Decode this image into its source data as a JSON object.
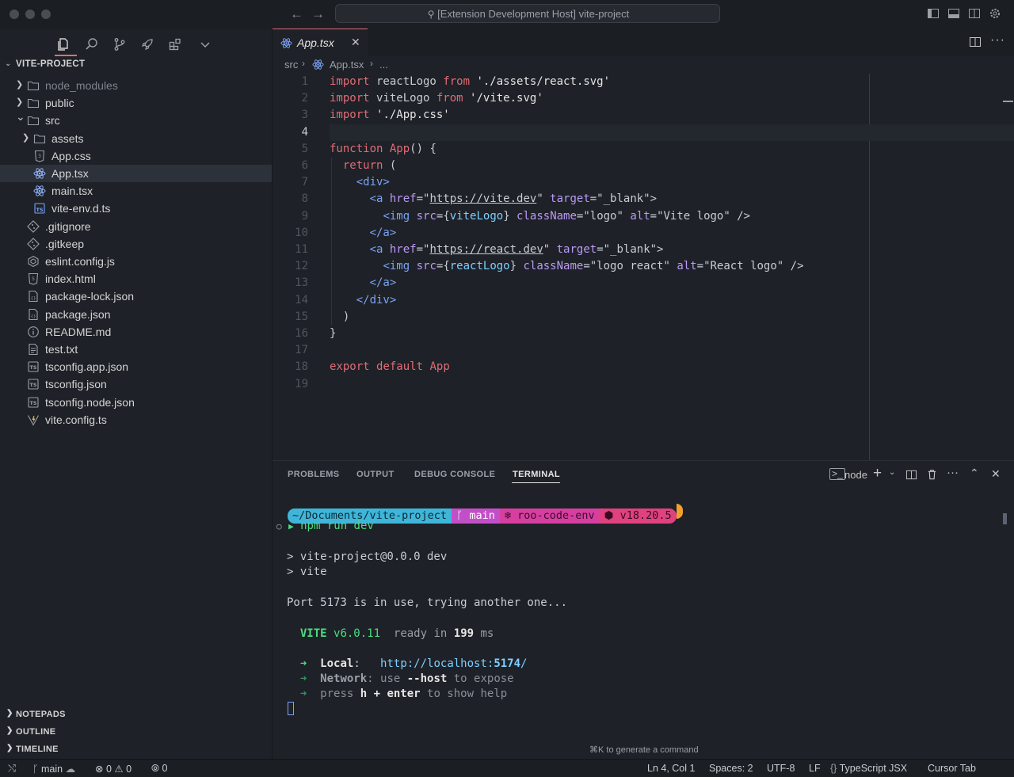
{
  "window": {
    "search_text": "[Extension Development Host] vite-project"
  },
  "explorer": {
    "title": "VITE-PROJECT",
    "items": [
      {
        "label": "node_modules",
        "icon": "folder-icon",
        "kind": "folder-collapsed",
        "depth": 0,
        "dim": true
      },
      {
        "label": "public",
        "icon": "folder-icon",
        "kind": "folder-collapsed",
        "depth": 0
      },
      {
        "label": "src",
        "icon": "folder-icon",
        "kind": "folder-expanded",
        "depth": 0
      },
      {
        "label": "assets",
        "icon": "folder-icon",
        "kind": "folder-collapsed",
        "depth": 1
      },
      {
        "label": "App.css",
        "icon": "css-icon",
        "kind": "file",
        "depth": 1
      },
      {
        "label": "App.tsx",
        "icon": "react-icon",
        "kind": "file",
        "depth": 1,
        "selected": true
      },
      {
        "label": "main.tsx",
        "icon": "react-icon",
        "kind": "file",
        "depth": 1
      },
      {
        "label": "vite-env.d.ts",
        "icon": "ts-icon",
        "kind": "file",
        "depth": 1
      },
      {
        "label": ".gitignore",
        "icon": "git-icon",
        "kind": "file",
        "depth": 0
      },
      {
        "label": ".gitkeep",
        "icon": "git-icon",
        "kind": "file",
        "depth": 0
      },
      {
        "label": "eslint.config.js",
        "icon": "eslint-icon",
        "kind": "file",
        "depth": 0
      },
      {
        "label": "index.html",
        "icon": "html-icon",
        "kind": "file",
        "depth": 0
      },
      {
        "label": "package-lock.json",
        "icon": "json-icon",
        "kind": "file",
        "depth": 0
      },
      {
        "label": "package.json",
        "icon": "json-icon",
        "kind": "file",
        "depth": 0
      },
      {
        "label": "README.md",
        "icon": "info-icon",
        "kind": "file",
        "depth": 0
      },
      {
        "label": "test.txt",
        "icon": "text-file-icon",
        "kind": "file",
        "depth": 0
      },
      {
        "label": "tsconfig.app.json",
        "icon": "ts-config-icon",
        "kind": "file",
        "depth": 0
      },
      {
        "label": "tsconfig.json",
        "icon": "ts-config-icon",
        "kind": "file",
        "depth": 0
      },
      {
        "label": "tsconfig.node.json",
        "icon": "ts-config-icon",
        "kind": "file",
        "depth": 0
      },
      {
        "label": "vite.config.ts",
        "icon": "vite-icon",
        "kind": "file",
        "depth": 0
      }
    ],
    "sections": [
      "NOTEPADS",
      "OUTLINE",
      "TIMELINE"
    ]
  },
  "editor": {
    "tab_label": "App.tsx",
    "breadcrumb": {
      "folder": "src",
      "file": "App.tsx",
      "more": "..."
    },
    "current_line": 4,
    "lines": [
      [
        [
          "kw",
          "import"
        ],
        [
          "pn",
          " reactLogo "
        ],
        [
          "kw",
          "from"
        ],
        [
          "pn",
          " "
        ],
        [
          "str",
          "'./assets/react.svg'"
        ]
      ],
      [
        [
          "kw",
          "import"
        ],
        [
          "pn",
          " viteLogo "
        ],
        [
          "kw",
          "from"
        ],
        [
          "pn",
          " "
        ],
        [
          "str",
          "'/vite.svg'"
        ]
      ],
      [
        [
          "kw",
          "import"
        ],
        [
          "pn",
          " "
        ],
        [
          "str",
          "'./App.css'"
        ]
      ],
      [],
      [
        [
          "kw",
          "function"
        ],
        [
          "pn",
          " "
        ],
        [
          "fn",
          "App"
        ],
        [
          "pn",
          "() {"
        ]
      ],
      [
        [
          "pn",
          "  "
        ],
        [
          "kw",
          "return"
        ],
        [
          "pn",
          " ("
        ]
      ],
      [
        [
          "pn",
          "    "
        ],
        [
          "tag",
          "<div>"
        ]
      ],
      [
        [
          "pn",
          "      "
        ],
        [
          "tag",
          "<a"
        ],
        [
          "pn",
          " "
        ],
        [
          "attr",
          "href"
        ],
        [
          "pn",
          "=\""
        ],
        [
          "ul",
          "https://vite.dev"
        ],
        [
          "pn",
          "\" "
        ],
        [
          "attr",
          "target"
        ],
        [
          "pn",
          "=\"_blank\">"
        ]
      ],
      [
        [
          "pn",
          "        "
        ],
        [
          "tag",
          "<img"
        ],
        [
          "pn",
          " "
        ],
        [
          "attr",
          "src"
        ],
        [
          "pn",
          "={"
        ],
        [
          "var",
          "viteLogo"
        ],
        [
          "pn",
          "} "
        ],
        [
          "attr",
          "className"
        ],
        [
          "pn",
          "=\"logo\" "
        ],
        [
          "attr",
          "alt"
        ],
        [
          "pn",
          "=\"Vite logo\" />"
        ]
      ],
      [
        [
          "pn",
          "      "
        ],
        [
          "tag",
          "</a>"
        ]
      ],
      [
        [
          "pn",
          "      "
        ],
        [
          "tag",
          "<a"
        ],
        [
          "pn",
          " "
        ],
        [
          "attr",
          "href"
        ],
        [
          "pn",
          "=\""
        ],
        [
          "ul",
          "https://react.dev"
        ],
        [
          "pn",
          "\" "
        ],
        [
          "attr",
          "target"
        ],
        [
          "pn",
          "=\"_blank\">"
        ]
      ],
      [
        [
          "pn",
          "        "
        ],
        [
          "tag",
          "<img"
        ],
        [
          "pn",
          " "
        ],
        [
          "attr",
          "src"
        ],
        [
          "pn",
          "={"
        ],
        [
          "var",
          "reactLogo"
        ],
        [
          "pn",
          "} "
        ],
        [
          "attr",
          "className"
        ],
        [
          "pn",
          "=\"logo react\" "
        ],
        [
          "attr",
          "alt"
        ],
        [
          "pn",
          "=\"React logo\" />"
        ]
      ],
      [
        [
          "pn",
          "      "
        ],
        [
          "tag",
          "</a>"
        ]
      ],
      [
        [
          "pn",
          "    "
        ],
        [
          "tag",
          "</div>"
        ]
      ],
      [
        [
          "pn",
          "  )"
        ]
      ],
      [
        [
          "pn",
          "}"
        ]
      ],
      [],
      [
        [
          "kw",
          "export"
        ],
        [
          "pn",
          " "
        ],
        [
          "kw",
          "default"
        ],
        [
          "pn",
          " "
        ],
        [
          "fn",
          "App"
        ]
      ],
      []
    ]
  },
  "panel": {
    "tabs": [
      "PROBLEMS",
      "OUTPUT",
      "DEBUG CONSOLE",
      "TERMINAL"
    ],
    "active_tab": "TERMINAL",
    "terminal_name": "node",
    "prompt": {
      "path": "~/Documents/vite-project",
      "branch": "main",
      "env": "roo-code-env",
      "node": "v18.20.5"
    },
    "command": "npm run dev",
    "output": {
      "line1": "> vite-project@0.0.0 dev",
      "line2": "> vite",
      "port_msg": "Port 5173 is in use, trying another one...",
      "vite": "VITE",
      "vite_version": "v6.0.11",
      "ready": "ready in",
      "ready_ms": "199",
      "ms": "ms",
      "local_label": "Local",
      "local_url_prefix": "http://localhost:",
      "local_port": "5174",
      "local_url_suffix": "/",
      "network_label": "Network",
      "network_text_a": ": use ",
      "network_flag": "--host",
      "network_text_b": " to expose",
      "help_a": "press ",
      "help_key": "h + enter",
      "help_b": " to show help"
    },
    "hint": "⌘K to generate a command"
  },
  "statusbar": {
    "branch": "main",
    "errors": "0",
    "warnings": "0",
    "ports": "0",
    "position": "Ln 4, Col 1",
    "spaces": "Spaces: 2",
    "encoding": "UTF-8",
    "eol": "LF",
    "language": "TypeScript JSX",
    "cursor_tab": "Cursor Tab"
  },
  "colors": {
    "accent": "#e06c75",
    "prompt_path_bg": "#3fb6d9",
    "prompt_branch_bg": "#c34fc8",
    "prompt_env_bg": "#d63fa0",
    "prompt_node_bg": "#e0427f",
    "vite_green": "#4ade80"
  }
}
